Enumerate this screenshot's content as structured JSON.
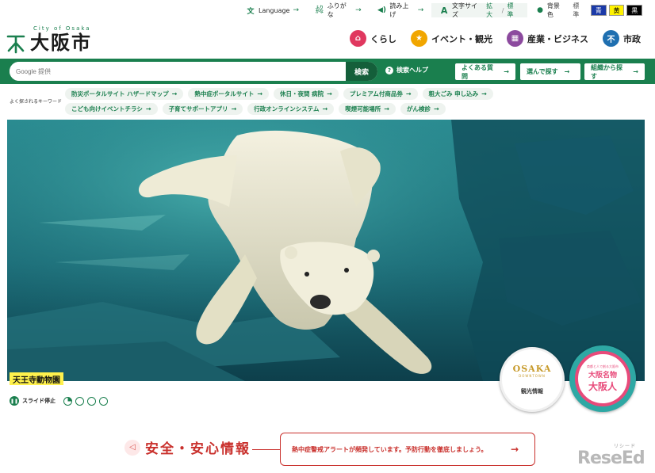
{
  "utility_bar": {
    "language": "Language",
    "furigana_icon": "ふり\nがな",
    "furigana": "ふりがな",
    "read_aloud": "読み上げ",
    "font_size_label": "文字サイズ",
    "font_size_options": [
      "拡大",
      "/",
      "標準"
    ],
    "bg_color_label": "背景色",
    "bg_color_options": [
      "標準",
      "青",
      "黄",
      "黒"
    ]
  },
  "header": {
    "logo_en": "City of Osaka",
    "logo_ja": "大阪市",
    "nav": [
      {
        "label": "くらし",
        "color": "#e0385f",
        "icon": "house-icon"
      },
      {
        "label": "イベント・観光",
        "color": "#f1a600",
        "icon": "star-icon"
      },
      {
        "label": "産業・ビジネス",
        "color": "#8c4a9e",
        "icon": "building-icon"
      },
      {
        "label": "市政",
        "color": "#1f6fb0",
        "icon": "city-mark-icon"
      }
    ]
  },
  "search": {
    "placeholder": "Google 提供",
    "button": "検索",
    "help": "検索ヘルプ",
    "quick_links": [
      "よくある質問",
      "選んで探す",
      "組織から探す"
    ]
  },
  "keywords": {
    "label": "よく探されるキーワード",
    "items": [
      "防災ポータルサイト ハザードマップ",
      "熱中症ポータルサイト",
      "休日・夜間 病院",
      "プレミアム付商品券",
      "粗大ごみ 申し込み",
      "こども向けイベントチラシ",
      "子育てサポートアプリ",
      "行政オンラインシステム",
      "喫煙可能場所",
      "がん検診"
    ]
  },
  "hero": {
    "caption": "天王寺動物園",
    "badge1_logo": "OSAKA",
    "badge1_sub": "DOWNTOWN",
    "badge1_label": "観光情報",
    "badge2_ring": "商都と人で創る大阪市",
    "badge2_title": "大阪名物",
    "badge2_big": "大阪人"
  },
  "slider": {
    "stop": "スライド停止",
    "dot_count": 4
  },
  "safety": {
    "title": "安全・安心情報",
    "alert": "熱中症警戒アラートが頻発しています。予防行動を徹底しましょう。"
  },
  "watermark": {
    "text": "ReseEd",
    "sub": "リシード"
  }
}
